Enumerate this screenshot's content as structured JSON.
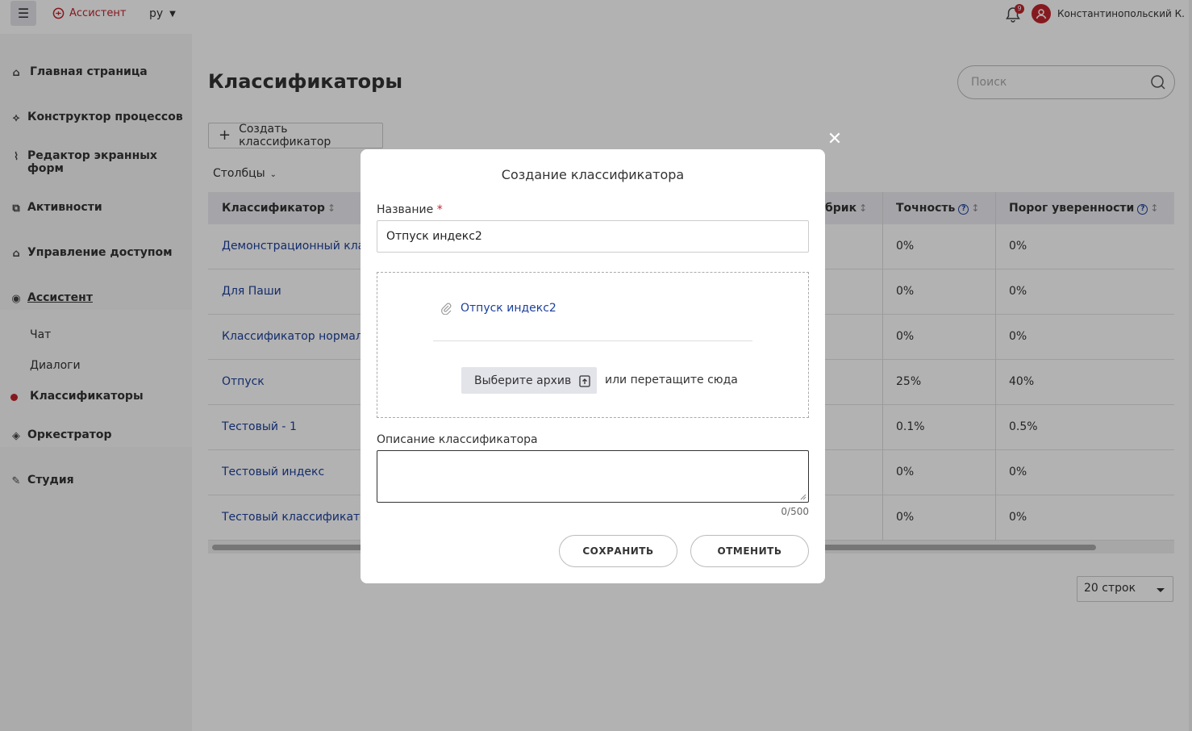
{
  "header": {
    "menu_icon": "hamburger-icon",
    "brand": "Ассистент",
    "language": "ру",
    "notifications_count": "9",
    "username": "Константинопольский К."
  },
  "sidebar": {
    "items": [
      {
        "label": "Главная страница",
        "icon": "home-icon"
      },
      {
        "label": "Конструктор процессов",
        "icon": "process-icon"
      },
      {
        "label": "Редактор экранных форм",
        "icon": "form-editor-icon"
      },
      {
        "label": "Активности",
        "icon": "activity-icon"
      },
      {
        "label": "Управление доступом",
        "icon": "lock-icon"
      },
      {
        "label": "Ассистент",
        "icon": "assistant-icon"
      },
      {
        "label": "Оркестратор",
        "icon": "orchestrator-icon"
      },
      {
        "label": "Студия",
        "icon": "studio-icon"
      }
    ],
    "sub_items": [
      {
        "label": "Чат"
      },
      {
        "label": "Диалоги"
      },
      {
        "label": "Классификаторы"
      }
    ]
  },
  "main": {
    "title": "Классификаторы",
    "search_placeholder": "Поиск",
    "create_button": "Создать классификатор",
    "columns_button": "Столбцы",
    "table": {
      "headers": [
        "Классификатор",
        "брик",
        "Точность",
        "Порог уверенности"
      ],
      "rows": [
        {
          "name": "Демонстрационный класс",
          "accuracy": "0%",
          "threshold": "0%"
        },
        {
          "name": "Для Паши",
          "accuracy": "0%",
          "threshold": "0%"
        },
        {
          "name": "Классификатор нормальн",
          "accuracy": "0%",
          "threshold": "0%"
        },
        {
          "name": "Отпуск",
          "accuracy": "25%",
          "threshold": "40%"
        },
        {
          "name": "Тестовый - 1",
          "accuracy": "0.1%",
          "threshold": "0.5%"
        },
        {
          "name": "Тестовый индекс",
          "accuracy": "0%",
          "threshold": "0%"
        },
        {
          "name": "Тестовый классификатор",
          "accuracy": "0%",
          "threshold": "0%"
        }
      ]
    },
    "rows_per_page": "20 строк"
  },
  "modal": {
    "title": "Создание классификатора",
    "name_label": "Название",
    "required_mark": "*",
    "name_value": "Отпуск индекс2",
    "file_name": "Отпуск индекс2",
    "choose_button": "Выберите архив",
    "drag_text": "или перетащите сюда",
    "description_label": "Описание классификатора",
    "counter": "0/500",
    "save_button": "СОХРАНИТЬ",
    "cancel_button": "ОТМЕНИТЬ"
  },
  "colors": {
    "brand_red": "#c0242d",
    "link_blue": "#1c3f9a"
  }
}
